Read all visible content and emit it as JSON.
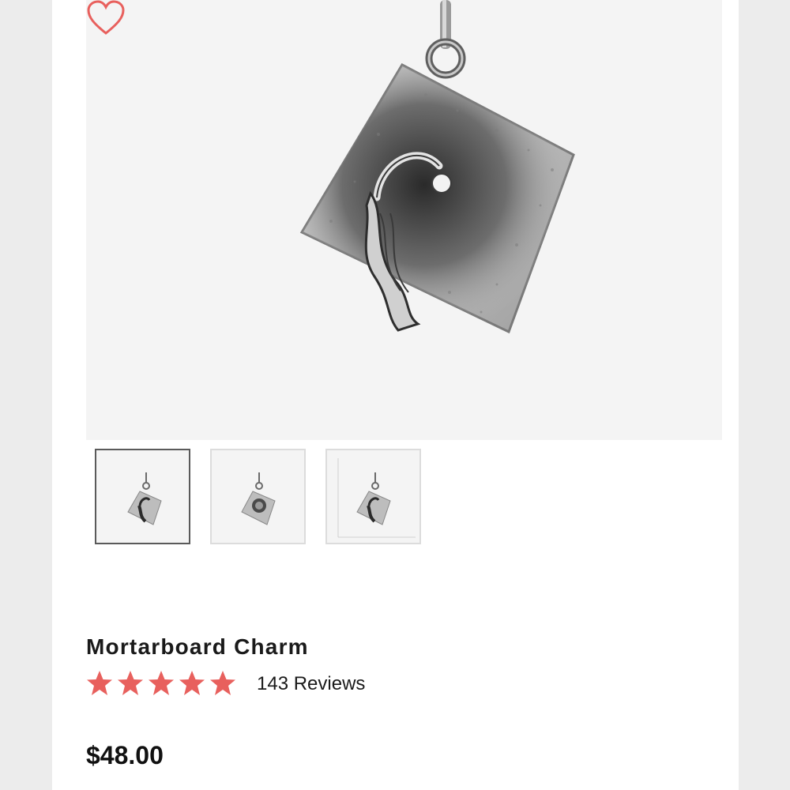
{
  "product": {
    "title": "Mortarboard Charm",
    "rating": {
      "stars": 5,
      "max": 5,
      "reviews_label": "143 Reviews"
    },
    "price": "$48.00"
  },
  "gallery": {
    "main_image_icon": "mortarboard-charm-photo",
    "favorite_icon": "heart-outline-icon",
    "thumbnails": [
      {
        "icon": "charm-front-thumbnail",
        "active": true
      },
      {
        "icon": "charm-back-thumbnail",
        "active": false
      },
      {
        "icon": "charm-size-chart-thumbnail",
        "active": false
      }
    ]
  },
  "colors": {
    "accent": "#e8605d",
    "background": "#ffffff",
    "image_bg": "#f4f4f4",
    "text": "#1a1a1a"
  }
}
